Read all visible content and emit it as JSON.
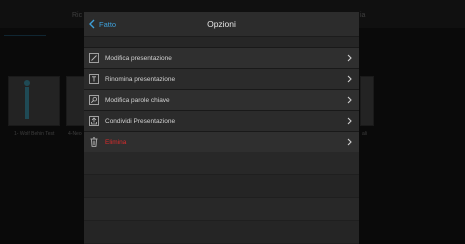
{
  "background": {
    "top_labels": [
      "Ric",
      "ia"
    ],
    "thumb_captions": [
      "1- Wolf Behin Test",
      "4-Neo",
      "ali"
    ]
  },
  "modal": {
    "back_label": "Fatto",
    "title": "Opzioni",
    "items": [
      {
        "label": "Modifica presentazione",
        "icon": "edit-icon",
        "danger": false
      },
      {
        "label": "Rinomina presentazione",
        "icon": "rename-text-icon",
        "danger": false
      },
      {
        "label": "Modifica parole chiave",
        "icon": "keyword-search-icon",
        "danger": false
      },
      {
        "label": "Condividi Presentazione",
        "icon": "share-icon",
        "danger": false
      },
      {
        "label": "Elimina",
        "icon": "trash-icon",
        "danger": true
      }
    ]
  },
  "colors": {
    "accent": "#3e9fd8",
    "danger": "#d92b2b",
    "row_text": "#d2d2d2"
  }
}
